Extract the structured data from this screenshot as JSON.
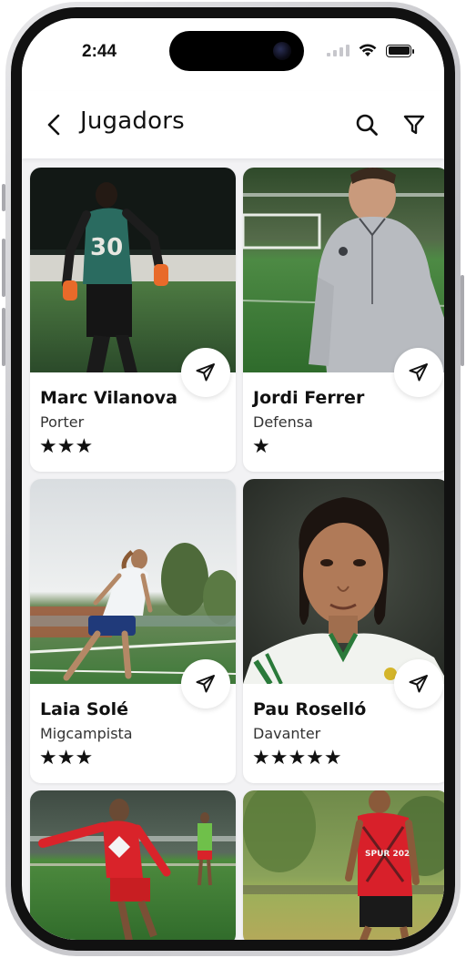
{
  "status_bar": {
    "time": "2:44",
    "icons": [
      "signal-icon",
      "wifi-icon",
      "battery-icon"
    ]
  },
  "nav": {
    "back_icon": "chevron-left-icon",
    "title": "Jugadors",
    "search_icon": "search-icon",
    "filter_icon": "filter-icon"
  },
  "players": [
    {
      "name": "Marc Vilanova",
      "role": "Porter",
      "stars": "★★★",
      "rating": 3,
      "photo": "goalkeeper-green-jersey-30"
    },
    {
      "name": "Jordi Ferrer",
      "role": "Defensa",
      "stars": "★",
      "rating": 1,
      "photo": "player-grey-quarter-zip"
    },
    {
      "name": "Laia Solé",
      "role": "Migcampista",
      "stars": "★★★",
      "rating": 3,
      "photo": "female-player-white-shirt-running"
    },
    {
      "name": "Pau Roselló",
      "role": "Davanter",
      "stars": "★★★★★",
      "rating": 5,
      "photo": "portrait-braided-hair-white-green-jersey"
    },
    {
      "photo": "player-red-kit-running"
    },
    {
      "photo": "player-red-black-training-shirt"
    }
  ],
  "colors": {
    "accent": "#111111",
    "screen_bg": "#f2f2f4",
    "card_bg": "#ffffff"
  }
}
